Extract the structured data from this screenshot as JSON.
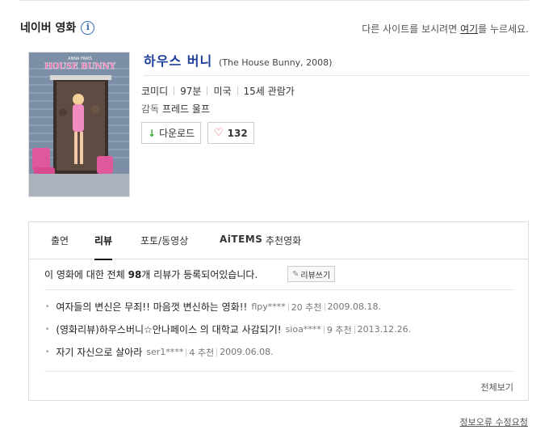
{
  "header": {
    "section_title": "네이버 영화",
    "external_note_prefix": "다른 사이트를 보시려면 ",
    "external_link": "여기",
    "external_note_suffix": "를 누르세요."
  },
  "poster": {
    "top_text": "ANNA FARIS",
    "title_text": "HOUSE BUNNY"
  },
  "movie": {
    "title": "하우스 버니",
    "original": "(The House Bunny, 2008)",
    "genre": "코미디",
    "runtime": "97분",
    "country": "미국",
    "rating": "15세 관람가",
    "director_label": "감독",
    "director": "프레드 울프",
    "download_label": "다운로드",
    "like_count": "132"
  },
  "tabs": [
    {
      "label": "출연"
    },
    {
      "label": "리뷰",
      "active": true
    },
    {
      "label": "포토/동영상"
    },
    {
      "label": "AiTEMS"
    },
    {
      "label": "추천영화"
    }
  ],
  "reviews_section": {
    "count_prefix": "이 영화에 대한 전체 ",
    "count": "98",
    "count_suffix": "개 리뷰가 등록되어있습니다.",
    "write_button": "리뷰쓰기",
    "more_link": "전체보기"
  },
  "reviews": [
    {
      "title": "여자들의 변신은 무죄!! 마음껏 변신하는 영화!!",
      "user": "flpy****",
      "recommend": "20 추천",
      "date": "2009.08.18."
    },
    {
      "title": "(영화리뷰)하우스버니☆안나페이스 의 대학교 사감되기!",
      "user": "sioa****",
      "recommend": "9 추천",
      "date": "2013.12.26."
    },
    {
      "title": "자기 자신으로 살아라",
      "user": "ser1****",
      "recommend": "4 추천",
      "date": "2009.06.08."
    }
  ],
  "footer": {
    "report_link": "정보오류 수정요청"
  }
}
